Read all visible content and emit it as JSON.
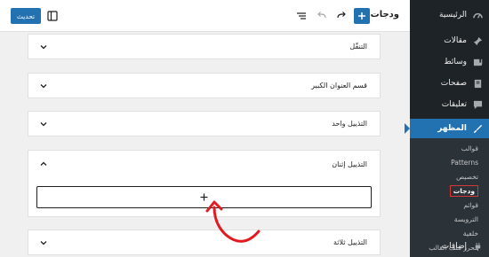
{
  "header": {
    "title": "ودجات",
    "update_label": "تحديث"
  },
  "sidebar": {
    "items": [
      {
        "label": "الرئيسية",
        "icon": "dashboard-icon"
      },
      {
        "label": "مقالات",
        "icon": "pin-icon"
      },
      {
        "label": "وسائط",
        "icon": "media-icon"
      },
      {
        "label": "صفحات",
        "icon": "page-icon"
      },
      {
        "label": "تعليقات",
        "icon": "comment-icon"
      },
      {
        "label": "المظهر",
        "icon": "brush-icon"
      }
    ],
    "submenu": [
      "قوالب",
      "Patterns",
      "تخصيص",
      "ودجات",
      "قوائم",
      "الترويسة",
      "خلفية",
      "محرر ملف القالب"
    ],
    "plugins_label": "إضافات"
  },
  "widget_areas": [
    {
      "title": "التنقّل"
    },
    {
      "title": "قسم العنوان الكبير"
    },
    {
      "title": "التذييل واحد"
    },
    {
      "title": "التذييل إثنان"
    },
    {
      "title": "التذييل ثلاثة"
    }
  ],
  "colors": {
    "accent": "#2271b1",
    "highlight_box": "#d63638",
    "annotation_arrow": "#e11b22"
  }
}
